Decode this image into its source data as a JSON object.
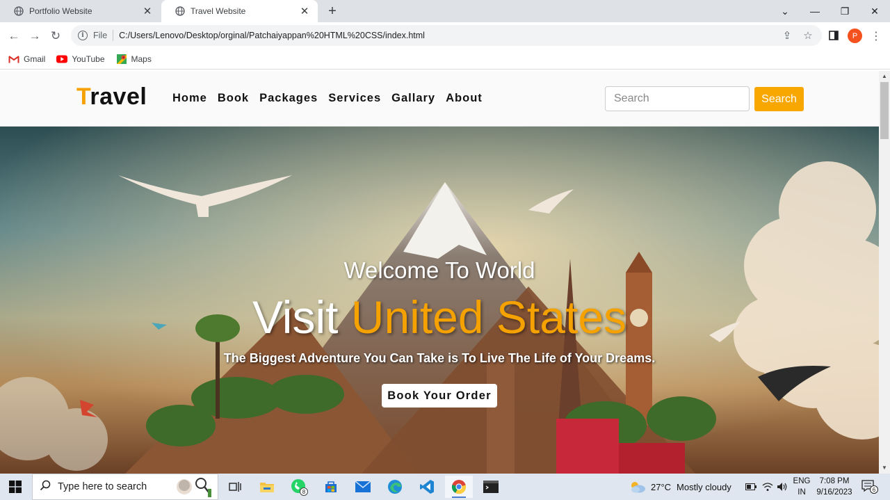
{
  "browser": {
    "tabs": [
      {
        "title": "Portfolio Website",
        "active": false
      },
      {
        "title": "Travel Website",
        "active": true
      }
    ],
    "new_tab_label": "+",
    "address": {
      "scheme": "File",
      "url": "C:/Users/Lenovo/Desktop/orginal/Patchaiyappan%20HTML%20CSS/index.html"
    },
    "profile_initial": "P",
    "bookmarks": [
      {
        "label": "Gmail",
        "icon": "gmail-icon"
      },
      {
        "label": "YouTube",
        "icon": "youtube-icon"
      },
      {
        "label": "Maps",
        "icon": "maps-icon"
      }
    ]
  },
  "site": {
    "logo_first": "T",
    "logo_rest": "ravel",
    "nav": [
      "Home",
      "Book",
      "Packages",
      "Services",
      "Gallary",
      "About"
    ],
    "search_placeholder": "Search",
    "search_button": "Search",
    "hero": {
      "welcome": "Welcome To World",
      "title_plain": "Visit ",
      "title_accent": "United States",
      "tagline": "The Biggest Adventure You Can Take is To Live The Life of Your Dreams.",
      "cta": "Book Your Order"
    },
    "accent_color": "#f5a200"
  },
  "taskbar": {
    "search_placeholder": "Type here to search",
    "whatsapp_badge": "8",
    "weather": {
      "temp": "27°C",
      "condition": "Mostly cloudy"
    },
    "language": {
      "line1": "ENG",
      "line2": "IN"
    },
    "time": "7:08 PM",
    "date": "9/16/2023",
    "notification_count": "6"
  }
}
